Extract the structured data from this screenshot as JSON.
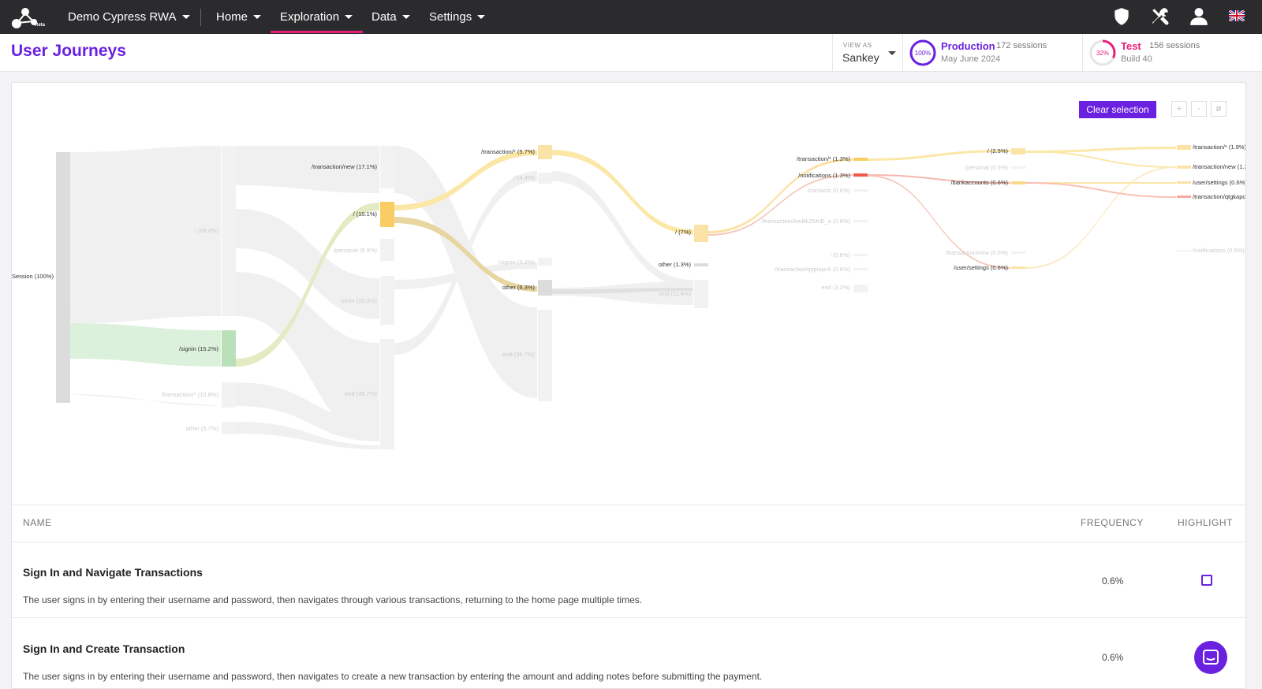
{
  "nav": {
    "logo_text": "Reta",
    "project": "Demo Cypress RWA",
    "items": [
      {
        "label": "Home"
      },
      {
        "label": "Exploration"
      },
      {
        "label": "Data"
      },
      {
        "label": "Settings"
      }
    ],
    "icons": [
      "shield-icon",
      "tools-icon",
      "user-icon",
      "uk-flag-icon"
    ]
  },
  "header": {
    "title": "User Journeys",
    "viewas_label": "VIEW AS",
    "viewas_value": "Sankey",
    "environments": [
      {
        "name": "Production",
        "ring_label": "100%",
        "sessions": "172 sessions",
        "sub": "May June 2024",
        "color": "#6b21e0",
        "fraction": 1.0
      },
      {
        "name": "Test",
        "ring_label": "32%",
        "sessions": "156 sessions",
        "sub": "Build 40",
        "color": "#e91e7a",
        "fraction": 0.32
      }
    ]
  },
  "toolbar": {
    "clear_label": "Clear selection",
    "zoom_in": "+",
    "zoom_out": "-",
    "reset": "ø"
  },
  "sankey": {
    "col0": [
      "Session (100%)"
    ],
    "col1": [
      "/ (68.4%)",
      "/signin (15.2%)",
      "/transaction/* (10.8%)",
      "other (5.7%)"
    ],
    "col2": [
      "/transaction/new (17.1%)",
      "/ (10.1%)",
      "/personal (6.9%)",
      "other (20.3%)",
      "end (45.7%)"
    ],
    "col3": [
      "/transaction/* (5.7%)",
      "/ (4.4%)",
      "/signin (3.2%)",
      "other (6.3%)",
      "end (36.7%)"
    ],
    "col4": [
      "/ (7%)",
      "other (1.3%)",
      "end (11.4%)"
    ],
    "col5": [
      "/transaction/* (1.3%)",
      "/notifications (1.3%)",
      "/contacts (0.6%)",
      "/transaction/bmBkZMnE_a (0.6%)",
      "/ (0.6%)",
      "/transaction/qtgkapc6 (0.6%)",
      "end (3.2%)"
    ],
    "col6": [
      "/ (2.5%)",
      "/personal (0.6%)",
      "/bankaccounts (0.6%)",
      "/transaction/new (0.6%)",
      "/user/settings (0.6%)"
    ],
    "col7": [
      "/transaction/* (1.9%)",
      "/transaction/new (1.3",
      "/user/settings (0.6%)",
      "/transaction/qtgkapc",
      "/notifications (0.6%)"
    ]
  },
  "table": {
    "headers": {
      "name": "NAME",
      "frequency": "FREQUENCY",
      "highlight": "HIGHLIGHT"
    },
    "rows": [
      {
        "title": "Sign In and Navigate Transactions",
        "description": "The user signs in by entering their username and password, then navigates through various transactions, returning to the home page multiple times.",
        "frequency": "0.6%"
      },
      {
        "title": "Sign In and Create Transaction",
        "description": "The user signs in by entering their username and password, then navigates to create a new transaction by entering the amount and adding notes before submitting the payment.",
        "frequency": "0.6%"
      }
    ]
  }
}
